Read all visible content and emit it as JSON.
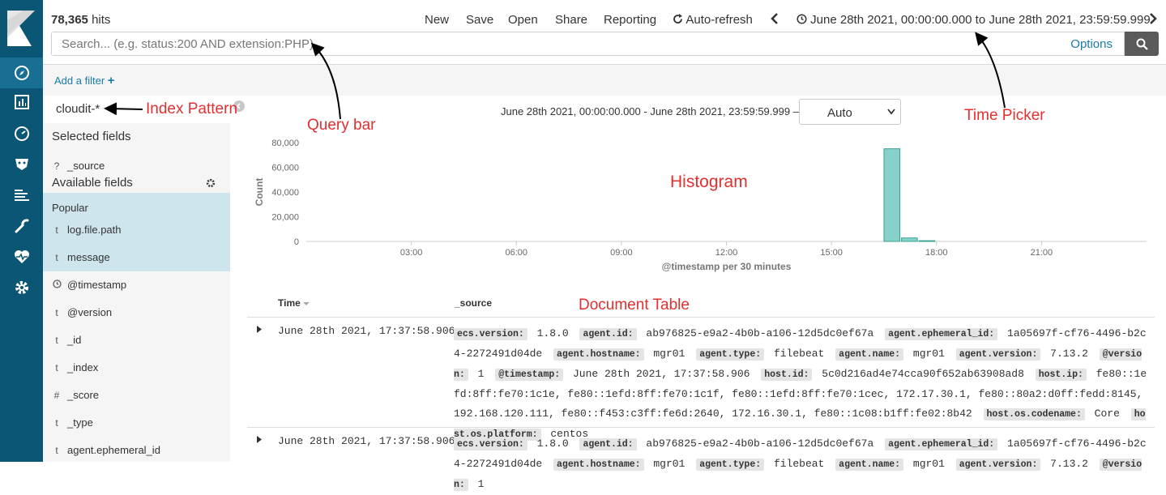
{
  "toolbar": {
    "hits_count": "78,365",
    "hits_label": "hits",
    "menu": [
      "New",
      "Save",
      "Open",
      "Share",
      "Reporting",
      "Auto-refresh"
    ],
    "time_range": "June 28th 2021, 00:00:00.000 to June 28th 2021, 23:59:59.999"
  },
  "search": {
    "placeholder": "Search... (e.g. status:200 AND extension:PHP)",
    "options_label": "Options"
  },
  "filter": {
    "add_label": "Add a filter"
  },
  "sidebar": {
    "index_pattern": "cloudit-*",
    "selected_title": "Selected fields",
    "selected_fields": [
      {
        "type": "?",
        "name": "_source"
      }
    ],
    "available_title": "Available fields",
    "popular_title": "Popular",
    "popular_fields": [
      {
        "type": "t",
        "name": "log.file.path"
      },
      {
        "type": "t",
        "name": "message"
      }
    ],
    "fields": [
      {
        "type": "clock",
        "name": "@timestamp"
      },
      {
        "type": "t",
        "name": "@version"
      },
      {
        "type": "t",
        "name": "_id"
      },
      {
        "type": "t",
        "name": "_index"
      },
      {
        "type": "#",
        "name": "_score"
      },
      {
        "type": "t",
        "name": "_type"
      },
      {
        "type": "t",
        "name": "agent.ephemeral_id"
      }
    ]
  },
  "histogram": {
    "date_range": "June 28th 2021, 00:00:00.000 - June 28th 2021, 23:59:59.999 —",
    "interval": "Auto"
  },
  "chart_data": {
    "type": "bar",
    "xlabel": "@timestamp per 30 minutes",
    "ylabel": "Count",
    "ylim": [
      0,
      80000
    ],
    "yticks": [
      "0",
      "20,000",
      "40,000",
      "60,000",
      "80,000"
    ],
    "xticks": [
      "03:00",
      "06:00",
      "09:00",
      "12:00",
      "15:00",
      "18:00",
      "21:00"
    ],
    "xrange_hours": [
      0,
      24
    ],
    "bars": [
      {
        "x": 16.5,
        "value": 75000
      },
      {
        "x": 17.0,
        "value": 2800
      },
      {
        "x": 17.5,
        "value": 600
      }
    ],
    "color": "#86d1c9"
  },
  "table": {
    "headers": [
      "Time",
      "_source"
    ],
    "rows": [
      {
        "time": "June 28th 2021, 17:37:58.906",
        "source": [
          [
            "ecs.version:",
            "1.8.0"
          ],
          [
            "agent.id:",
            "ab976825-e9a2-4b0b-a106-12d5dc0ef67a"
          ],
          [
            "agent.ephemeral_id:",
            "1a05697f-cf76-4496-b2c4-2272491d04de"
          ],
          [
            "agent.hostname:",
            "mgr01"
          ],
          [
            "agent.type:",
            "filebeat"
          ],
          [
            "agent.name:",
            "mgr01"
          ],
          [
            "agent.version:",
            "7.13.2"
          ],
          [
            "@version:",
            "1"
          ],
          [
            "@timestamp:",
            "June 28th 2021, 17:37:58.906"
          ],
          [
            "host.id:",
            "5c0d216ad4e74cca90f652ab63908ad8"
          ],
          [
            "host.ip:",
            "fe80::1efd:8ff:fe70:1c1e, fe80::1efd:8ff:fe70:1c1f, fe80::1efd:8ff:fe70:1cec, 172.17.30.1, fe80::80a2:d0ff:fedd:8145, 192.168.120.111, fe80::f453:c3ff:fe6d:2640, 172.16.30.1, fe80::1c08:b1ff:fe02:8b42"
          ],
          [
            "host.os.codename:",
            "Core"
          ],
          [
            "host.os.platform:",
            "centos"
          ]
        ]
      },
      {
        "time": "June 28th 2021, 17:37:58.906",
        "source": [
          [
            "ecs.version:",
            "1.8.0"
          ],
          [
            "agent.id:",
            "ab976825-e9a2-4b0b-a106-12d5dc0ef67a"
          ],
          [
            "agent.ephemeral_id:",
            "1a05697f-cf76-4496-b2c4-2272491d04de"
          ],
          [
            "agent.hostname:",
            "mgr01"
          ],
          [
            "agent.type:",
            "filebeat"
          ],
          [
            "agent.name:",
            "mgr01"
          ],
          [
            "agent.version:",
            "7.13.2"
          ],
          [
            "@version:",
            "1"
          ]
        ]
      }
    ]
  },
  "annotations": {
    "index_pattern": "Index Pattern",
    "query_bar": "Query bar",
    "time_picker": "Time Picker",
    "histogram": "Histogram",
    "document_table": "Document Table"
  }
}
